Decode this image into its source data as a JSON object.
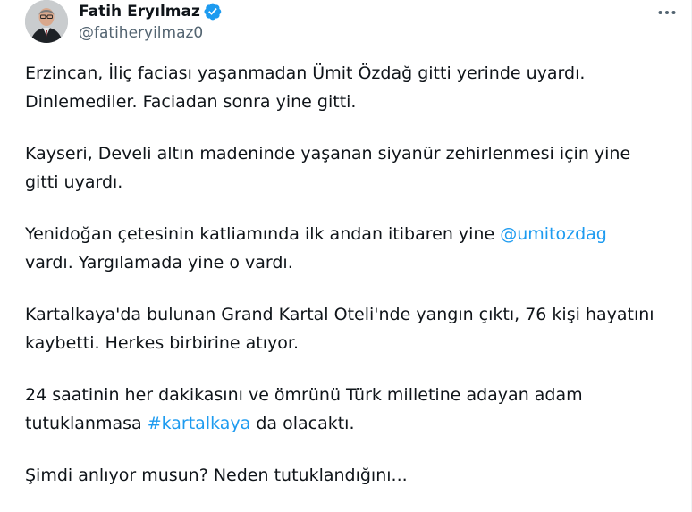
{
  "author": {
    "display_name": "Fatih Eryılmaz",
    "handle": "@fatiheryilmaz0"
  },
  "colors": {
    "text": "#0f1419",
    "secondary": "#536471",
    "link": "#1d9bf0",
    "verified": "#1d9bf0"
  },
  "tweet": {
    "p1": {
      "l1": "Erzincan, İliç faciası yaşanmadan Ümit Özdağ gitti yerinde uyardı.",
      "l2": "Dinlemediler. Faciadan sonra yine gitti."
    },
    "p2": {
      "l1": "Kayseri, Develi altın madeninde yaşanan siyanür zehirlenmesi için yine",
      "l2": "gitti uyardı."
    },
    "p3": {
      "l1_pre": "Yenidoğan çetesinin katliamında ilk andan itibaren yine ",
      "mention": "@umitozdag",
      "l2": "vardı. Yargılamada yine o vardı."
    },
    "p4": {
      "l1": "Kartalkaya'da bulunan Grand Kartal Oteli'nde yangın çıktı, 76 kişi hayatını",
      "l2": "kaybetti. Herkes birbirine atıyor."
    },
    "p5": {
      "l1": "24 saatinin her dakikasını ve ömrünü Türk milletine adayan adam",
      "l2_pre": "tutuklanmasa ",
      "hashtag": "#kartalkaya",
      "l2_post": " da olacaktı."
    },
    "p6": {
      "l1": "Şimdi anlıyor musun? Neden tutuklandığını..."
    }
  },
  "icons": {
    "verified": "verified-badge-icon",
    "more": "more-options-icon"
  }
}
